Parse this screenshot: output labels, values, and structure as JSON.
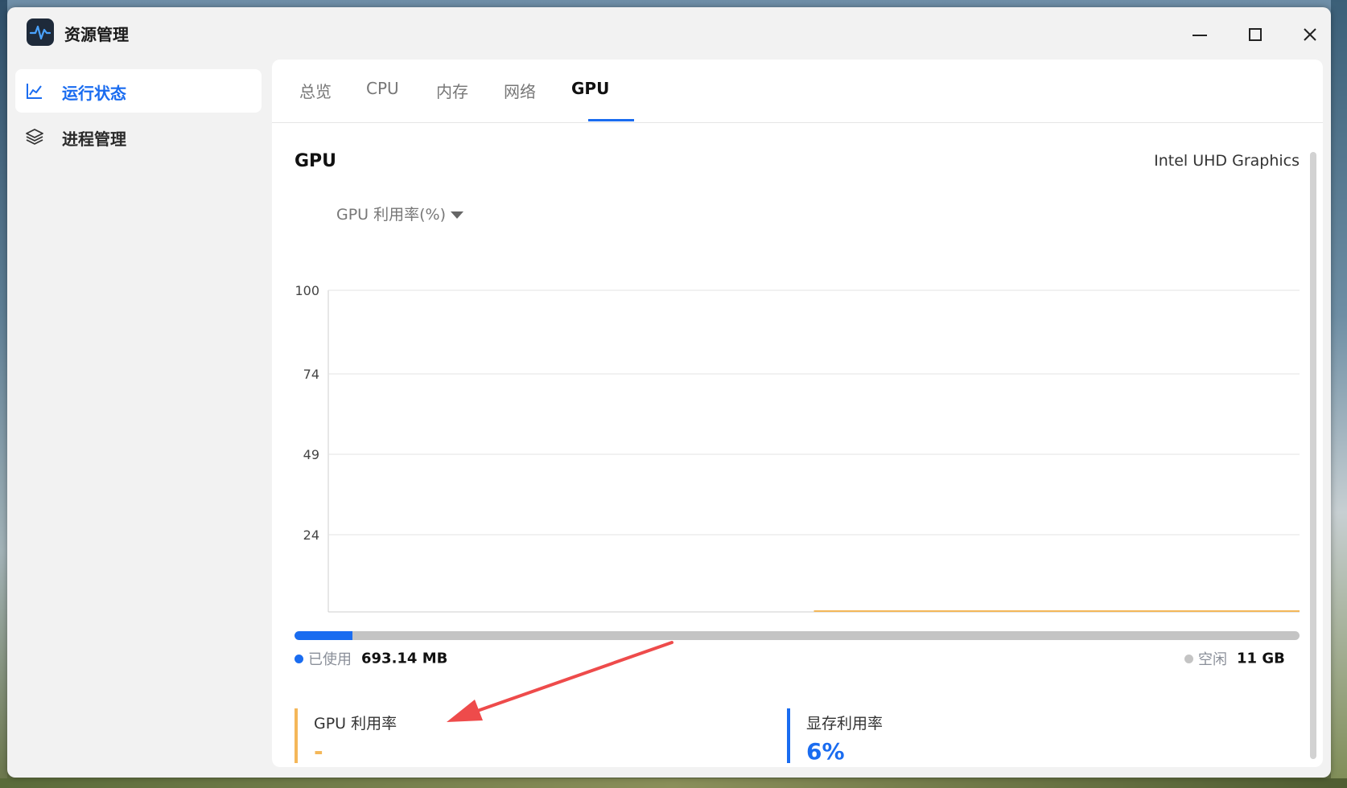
{
  "app": {
    "title": "资源管理"
  },
  "window_controls": {
    "minimize": "minimize-icon",
    "maximize": "maximize-icon",
    "close": "close-icon"
  },
  "sidebar": {
    "items": [
      {
        "label": "运行状态",
        "icon": "line-chart-icon",
        "active": true
      },
      {
        "label": "进程管理",
        "icon": "layers-icon",
        "active": false
      }
    ]
  },
  "tabs": [
    {
      "label": "总览"
    },
    {
      "label": "CPU"
    },
    {
      "label": "内存"
    },
    {
      "label": "网络"
    },
    {
      "label": "GPU",
      "active": true
    }
  ],
  "gpu": {
    "title": "GPU",
    "model": "Intel UHD Graphics",
    "metric_select": "GPU 利用率(%)"
  },
  "chart_data": {
    "type": "line",
    "title": "",
    "xlabel": "",
    "ylabel": "",
    "y_ticks": [
      "100",
      "74",
      "49",
      "24"
    ],
    "ylim": [
      0,
      100
    ],
    "grid": true,
    "series": [
      {
        "values": [
          null,
          null,
          null,
          null,
          null,
          0,
          0,
          0,
          0,
          0,
          0
        ],
        "color": "#f4b759"
      }
    ]
  },
  "memory": {
    "used_fraction": 0.058,
    "used_label": "已使用",
    "used_value": "693.14 MB",
    "free_label": "空闲",
    "free_value": "11 GB"
  },
  "stats": {
    "gpu_util_label": "GPU 利用率",
    "gpu_util_value": "-",
    "vram_util_label": "显存利用率",
    "vram_util_value": "6%"
  },
  "colors": {
    "accent": "#1a6cf0",
    "gpu_series": "#f4b759",
    "annotation_arrow": "#ee4b4b"
  }
}
